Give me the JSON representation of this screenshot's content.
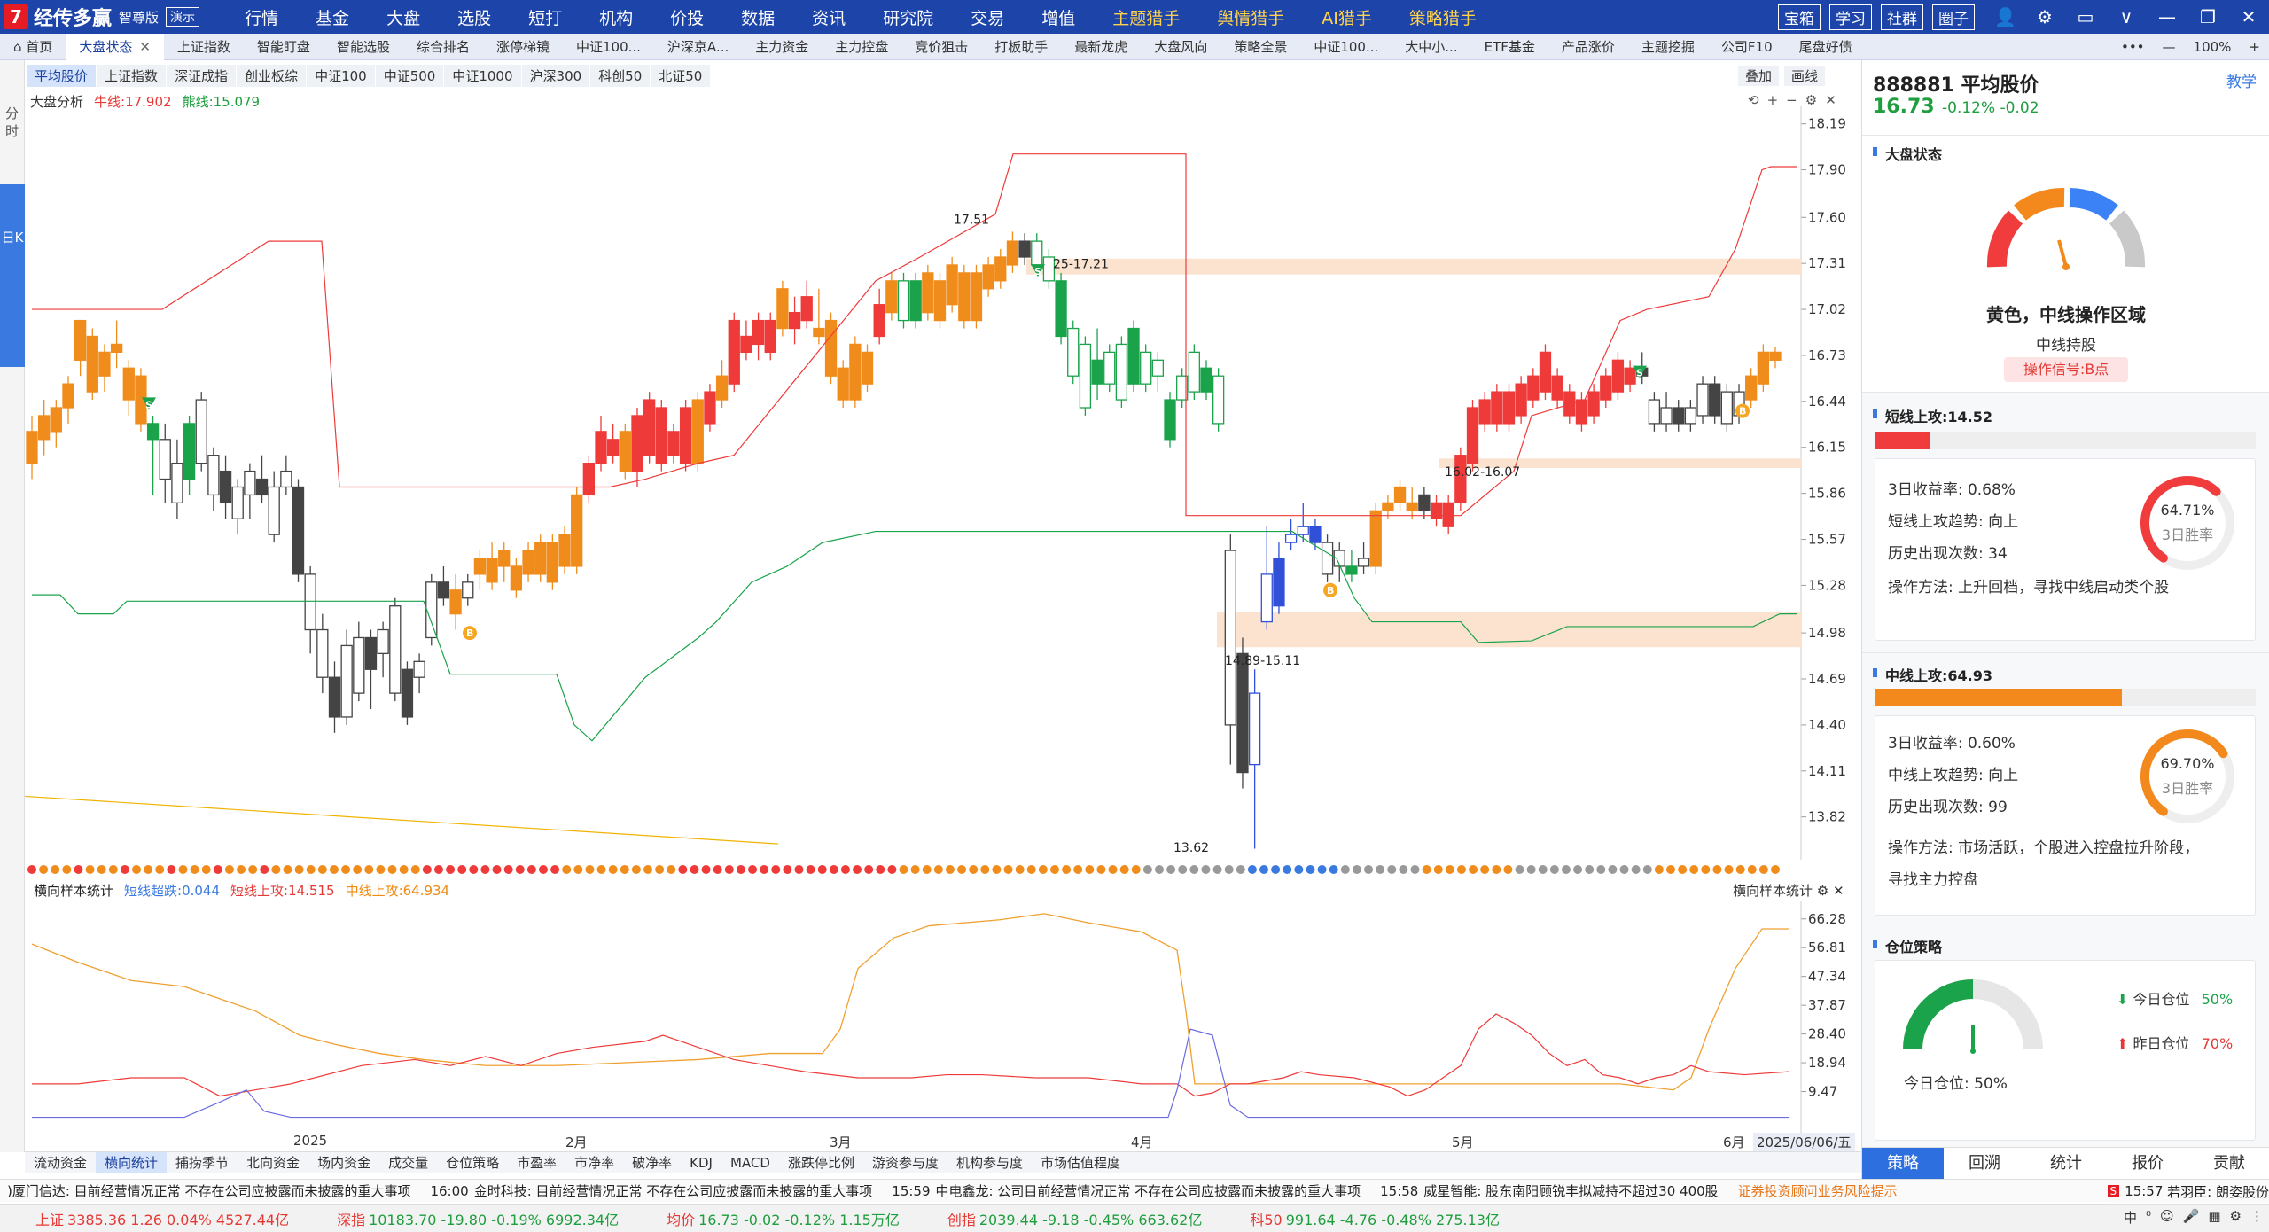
{
  "app": {
    "logo_char": "7",
    "name": "经传多赢",
    "edition": "智尊版",
    "demo": "演示"
  },
  "menu": [
    {
      "label": "行情",
      "dot": false
    },
    {
      "label": "基金",
      "dot": false
    },
    {
      "label": "大盘",
      "dot": false
    },
    {
      "label": "选股",
      "dot": false
    },
    {
      "label": "短打",
      "dot": false
    },
    {
      "label": "机构",
      "dot": false
    },
    {
      "label": "价投",
      "dot": false
    },
    {
      "label": "数据",
      "dot": true
    },
    {
      "label": "资讯",
      "dot": false
    },
    {
      "label": "研究院",
      "dot": false
    },
    {
      "label": "交易",
      "dot": false
    },
    {
      "label": "增值",
      "dot": false
    },
    {
      "label": "主题猎手",
      "dot": false,
      "hl": true
    },
    {
      "label": "舆情猎手",
      "dot": false,
      "hl": true
    },
    {
      "label": "AI猎手",
      "dot": false,
      "hl": true
    },
    {
      "label": "策略猎手",
      "dot": true,
      "hl": true
    }
  ],
  "top_right": {
    "buttons": [
      "宝箱",
      "学习",
      "社群",
      "圈子"
    ],
    "icons": [
      "user-icon",
      "gear-icon",
      "window-icon",
      "chevron-down-icon",
      "minimize-icon",
      "restore-icon",
      "close-icon"
    ],
    "icon_glyphs": [
      "👤",
      "⚙",
      "▭",
      "∨",
      "—",
      "❐",
      "✕"
    ]
  },
  "tabs": [
    {
      "label": "首页",
      "active": false,
      "home": true
    },
    {
      "label": "大盘状态",
      "active": true,
      "close": true
    },
    {
      "label": "上证指数",
      "active": false
    },
    {
      "label": "智能盯盘",
      "active": false
    },
    {
      "label": "智能选股",
      "active": false
    },
    {
      "label": "综合排名",
      "active": false
    },
    {
      "label": "涨停梯镜",
      "active": false
    },
    {
      "label": "中证100...",
      "active": false
    },
    {
      "label": "沪深京A...",
      "active": false
    },
    {
      "label": "主力资金",
      "active": false
    },
    {
      "label": "主力控盘",
      "active": false
    },
    {
      "label": "竞价狙击",
      "active": false
    },
    {
      "label": "打板助手",
      "active": false
    },
    {
      "label": "最新龙虎",
      "active": false
    },
    {
      "label": "大盘风向",
      "active": false
    },
    {
      "label": "策略全景",
      "active": false
    },
    {
      "label": "中证100...",
      "active": false
    },
    {
      "label": "大中小...",
      "active": false
    },
    {
      "label": "ETF基金",
      "active": false
    },
    {
      "label": "产品涨价",
      "active": false
    },
    {
      "label": "主题挖掘",
      "active": false
    },
    {
      "label": "公司F10",
      "active": false
    },
    {
      "label": "尾盘好债",
      "active": false
    }
  ],
  "tab_right": {
    "more": "•••",
    "zoom": "100%",
    "minus": "—",
    "plus": "+"
  },
  "left_strip": {
    "fenshi": "分时",
    "rik": "日K"
  },
  "subtabs": [
    {
      "label": "平均股价",
      "active": true
    },
    {
      "label": "上证指数",
      "active": false
    },
    {
      "label": "深证成指",
      "active": false
    },
    {
      "label": "创业板综",
      "active": false
    },
    {
      "label": "中证100",
      "active": false
    },
    {
      "label": "中证500",
      "active": false
    },
    {
      "label": "中证1000",
      "active": false
    },
    {
      "label": "沪深300",
      "active": false
    },
    {
      "label": "科创50",
      "active": false
    },
    {
      "label": "北证50",
      "active": false
    }
  ],
  "sub_right": [
    "叠加",
    "画线"
  ],
  "chart_head": {
    "label": "大盘分析",
    "bull": "牛线:17.902",
    "bear": "熊线:15.079"
  },
  "chart_icons": [
    "⟲",
    "+",
    "−",
    "⚙",
    "✕"
  ],
  "chart_data": {
    "type": "candlestick",
    "y_ticks": [
      "18.19",
      "17.90",
      "17.60",
      "17.31",
      "17.02",
      "16.73",
      "16.44",
      "16.15",
      "15.86",
      "15.57",
      "15.28",
      "14.98",
      "14.69",
      "14.40",
      "14.11",
      "13.82"
    ],
    "annotations": [
      "17.51",
      "25-17.21",
      "16.02-16.07",
      "14.89-15.11",
      "13.62"
    ],
    "indicator_y_ticks": [
      "66.28",
      "56.81",
      "47.34",
      "37.87",
      "28.40",
      "18.94",
      "9.47"
    ],
    "months": [
      "2025",
      "2月",
      "3月",
      "4月",
      "5月",
      "6月"
    ],
    "date": "2025/06/06/五"
  },
  "indicator_head": {
    "title": "横向样本统计",
    "a": "短线超跌:0.044",
    "b": "短线上攻:14.515",
    "c": "中线上攻:64.934"
  },
  "indicator_right": "横向样本统计",
  "bottom_tabs": [
    {
      "label": "流动资金",
      "active": false
    },
    {
      "label": "横向统计",
      "active": true
    },
    {
      "label": "捕捞季节",
      "active": false
    },
    {
      "label": "北向资金",
      "active": false
    },
    {
      "label": "场内资金",
      "active": false
    },
    {
      "label": "成交量",
      "active": false
    },
    {
      "label": "仓位策略",
      "active": false
    },
    {
      "label": "市盈率",
      "active": false
    },
    {
      "label": "市净率",
      "active": false
    },
    {
      "label": "破净率",
      "active": false
    },
    {
      "label": "KDJ",
      "active": false
    },
    {
      "label": "MACD",
      "active": false
    },
    {
      "label": "涨跌停比例",
      "active": false
    },
    {
      "label": "游资参与度",
      "active": false
    },
    {
      "label": "机构参与度",
      "active": false
    },
    {
      "label": "市场估值程度",
      "active": false
    }
  ],
  "news": [
    {
      "time": "",
      "text": ")厦门信达: 目前经营情况正常 不存在公司应披露而未披露的重大事项",
      "orange": false
    },
    {
      "time": "16:00",
      "text": "金时科技: 目前经营情况正常 不存在公司应披露而未披露的重大事项",
      "orange": false
    },
    {
      "time": "15:59",
      "text": "中电鑫龙: 公司目前经营情况正常 不存在公司应披露而未披露的重大事项",
      "orange": false
    },
    {
      "time": "15:58",
      "text": "威星智能: 股东南阳顾锐丰拟减持不超过30 400股",
      "orange": false
    },
    {
      "time": "",
      "text": "证券投资顾问业务风险提示",
      "orange": true
    }
  ],
  "news_right": {
    "badge": "S",
    "time": "15:57",
    "text": "若羽臣: 朗姿股份"
  },
  "status_indices": [
    {
      "name": "上证",
      "value": "3385.36",
      "chg": "1.26",
      "pct": "0.04%",
      "amt": "4527.44亿",
      "dir": "up"
    },
    {
      "name": "深指",
      "value": "10183.70",
      "chg": "-19.80",
      "pct": "-0.19%",
      "amt": "6992.34亿",
      "dir": "dn"
    },
    {
      "name": "均价",
      "value": "16.73",
      "chg": "-0.02",
      "pct": "-0.12%",
      "amt": "1.15万亿",
      "dir": "dn"
    },
    {
      "name": "创指",
      "value": "2039.44",
      "chg": "-9.18",
      "pct": "-0.45%",
      "amt": "663.62亿",
      "dir": "dn"
    },
    {
      "name": "科50",
      "value": "991.64",
      "chg": "-4.76",
      "pct": "-0.48%",
      "amt": "275.13亿",
      "dir": "dn"
    }
  ],
  "status_right": [
    "中",
    "⁰",
    "☺",
    "🎤",
    "▦",
    "⚙",
    "⋮"
  ],
  "right_panel": {
    "code": "888881 平均股价",
    "teach": "教学",
    "price": "16.73",
    "chg": "-0.12%  -0.02",
    "market_state": {
      "title": "大盘状态",
      "line1": "黄色，中线操作区域",
      "line2": "中线持股",
      "signal": "操作信号:B点"
    },
    "short": {
      "title": "短线上攻:14.52",
      "fill": 0.145,
      "ret3": "3日收益率: 0.68%",
      "trend": "短线上攻趋势: 向上",
      "count": "历史出现次数: 34",
      "method": "操作方法: 上升回档，寻找中线启动类个股",
      "ring_pct": "64.71%",
      "ring_lbl": "3日胜率",
      "ring_val": 0.6471
    },
    "mid": {
      "title": "中线上攻:64.93",
      "fill": 0.6493,
      "ret3": "3日收益率: 0.60%",
      "trend": "中线上攻趋势: 向上",
      "count": "历史出现次数: 99",
      "method1": "操作方法: 市场活跃，个股进入控盘拉升阶段，",
      "method2": "寻找主力控盘",
      "ring_pct": "69.70%",
      "ring_lbl": "3日胜率",
      "ring_val": 0.697
    },
    "position": {
      "title": "仓位策略",
      "today": "今日仓位",
      "today_v": "50%",
      "yest": "昨日仓位",
      "yest_v": "70%",
      "gauge_lbl": "今日仓位: 50%"
    },
    "tabs": [
      {
        "label": "策略",
        "active": true
      },
      {
        "label": "回溯",
        "active": false
      },
      {
        "label": "统计",
        "active": false
      },
      {
        "label": "报价",
        "active": false
      },
      {
        "label": "贡献",
        "active": false
      }
    ]
  }
}
